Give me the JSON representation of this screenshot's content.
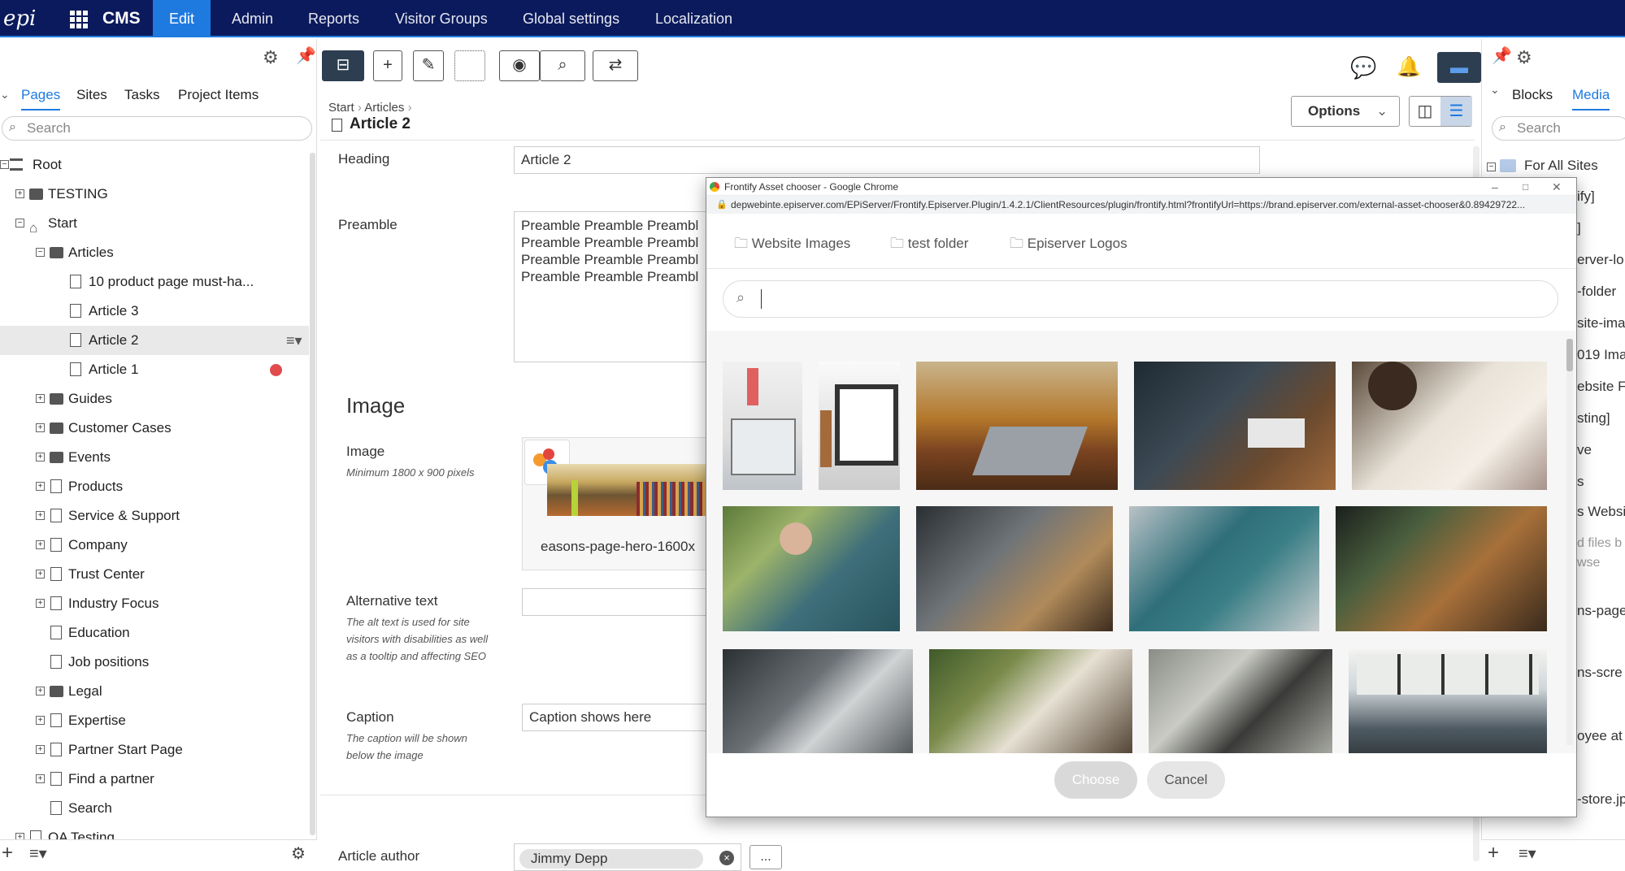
{
  "topnav": {
    "logo": "epi",
    "brand": "CMS",
    "items": [
      "Edit",
      "Admin",
      "Reports",
      "Visitor Groups",
      "Global settings",
      "Localization"
    ]
  },
  "left_panel": {
    "tabs": [
      "Pages",
      "Sites",
      "Tasks",
      "Project Items"
    ],
    "search_placeholder": "Search",
    "tree": [
      {
        "label": "Root",
        "level": 0,
        "type": "root",
        "expander": "-"
      },
      {
        "label": "TESTING",
        "level": 1,
        "type": "folder",
        "expander": "+"
      },
      {
        "label": "Start",
        "level": 1,
        "type": "home",
        "expander": "-"
      },
      {
        "label": "Articles",
        "level": 2,
        "type": "folder",
        "expander": "-"
      },
      {
        "label": "10 product page must-ha...",
        "level": 3,
        "type": "page"
      },
      {
        "label": "Article 3",
        "level": 3,
        "type": "page"
      },
      {
        "label": "Article 2",
        "level": 3,
        "type": "page",
        "selected": true
      },
      {
        "label": "Article 1",
        "level": 3,
        "type": "page",
        "badge": "clock"
      },
      {
        "label": "Guides",
        "level": 2,
        "type": "folder",
        "expander": "+"
      },
      {
        "label": "Customer Cases",
        "level": 2,
        "type": "folder",
        "expander": "+"
      },
      {
        "label": "Events",
        "level": 2,
        "type": "folder",
        "expander": "+"
      },
      {
        "label": "Products",
        "level": 2,
        "type": "page",
        "expander": "+"
      },
      {
        "label": "Service & Support",
        "level": 2,
        "type": "page",
        "expander": "+"
      },
      {
        "label": "Company",
        "level": 2,
        "type": "page",
        "expander": "+"
      },
      {
        "label": "Trust Center",
        "level": 2,
        "type": "page",
        "expander": "+"
      },
      {
        "label": "Industry Focus",
        "level": 2,
        "type": "page",
        "expander": "+"
      },
      {
        "label": "Education",
        "level": 2,
        "type": "page"
      },
      {
        "label": "Job positions",
        "level": 2,
        "type": "page"
      },
      {
        "label": "Legal",
        "level": 2,
        "type": "folder",
        "expander": "+"
      },
      {
        "label": "Expertise",
        "level": 2,
        "type": "page",
        "expander": "+"
      },
      {
        "label": "Partner Start Page",
        "level": 2,
        "type": "page",
        "expander": "+"
      },
      {
        "label": "Find a partner",
        "level": 2,
        "type": "page",
        "expander": "+"
      },
      {
        "label": "Search",
        "level": 2,
        "type": "page"
      },
      {
        "label": "QA Testing",
        "level": 1,
        "type": "page",
        "expander": "+"
      }
    ]
  },
  "breadcrumb": [
    "Start",
    "Articles"
  ],
  "page_title": "Article 2",
  "options_label": "Options",
  "form": {
    "heading_label": "Heading",
    "heading_value": "Article 2",
    "preamble_label": "Preamble",
    "preamble_lines": [
      "Preamble Preamble Preambl",
      "Preamble Preamble Preambl",
      "Preamble Preamble Preambl",
      "Preamble Preamble Preambl"
    ],
    "image_section": "Image",
    "image_label": "Image",
    "image_hint": "Minimum 1800 x 900 pixels",
    "image_filename": "easons-page-hero-1600x",
    "alt_label": "Alternative text",
    "alt_hint": "The alt text is used for site visitors with disabilities as well as a tooltip and affecting SEO",
    "caption_label": "Caption",
    "caption_hint": "The caption will be shown below the image",
    "caption_value": "Caption shows here",
    "author_label": "Article author",
    "author_value": "Jimmy Depp",
    "author_more": "..."
  },
  "right_panel": {
    "tabs": [
      "Blocks",
      "Media"
    ],
    "search_placeholder": "Search",
    "items": [
      "For All Sites",
      "ify]",
      "]",
      "erver-lo",
      "-folder",
      "site-ima",
      "019 Imag",
      "ebsite F",
      "sting]",
      "ve",
      "s",
      "s Websit",
      "d files b",
      "wse",
      "ns-page",
      "ns-scre",
      "oyee at",
      "-store.jp"
    ]
  },
  "modal": {
    "window_title": "Frontify Asset chooser - Google Chrome",
    "url": "depwebinte.episerver.com/EPiServer/Frontify.Episerver.Plugin/1.4.2.1/ClientResources/plugin/frontify.html?frontifyUrl=https://brand.episerver.com/external-asset-chooser&0.89429722...",
    "folders": [
      "Website Images",
      "test folder",
      "Episerver Logos"
    ],
    "search_value": "",
    "choose_label": "Choose",
    "cancel_label": "Cancel"
  },
  "colors": {
    "topnav_bg": "#0b1a5c",
    "accent": "#1f7ae0",
    "toolbar_dark": "#2c3e50",
    "badge_red": "#e04b4b"
  }
}
